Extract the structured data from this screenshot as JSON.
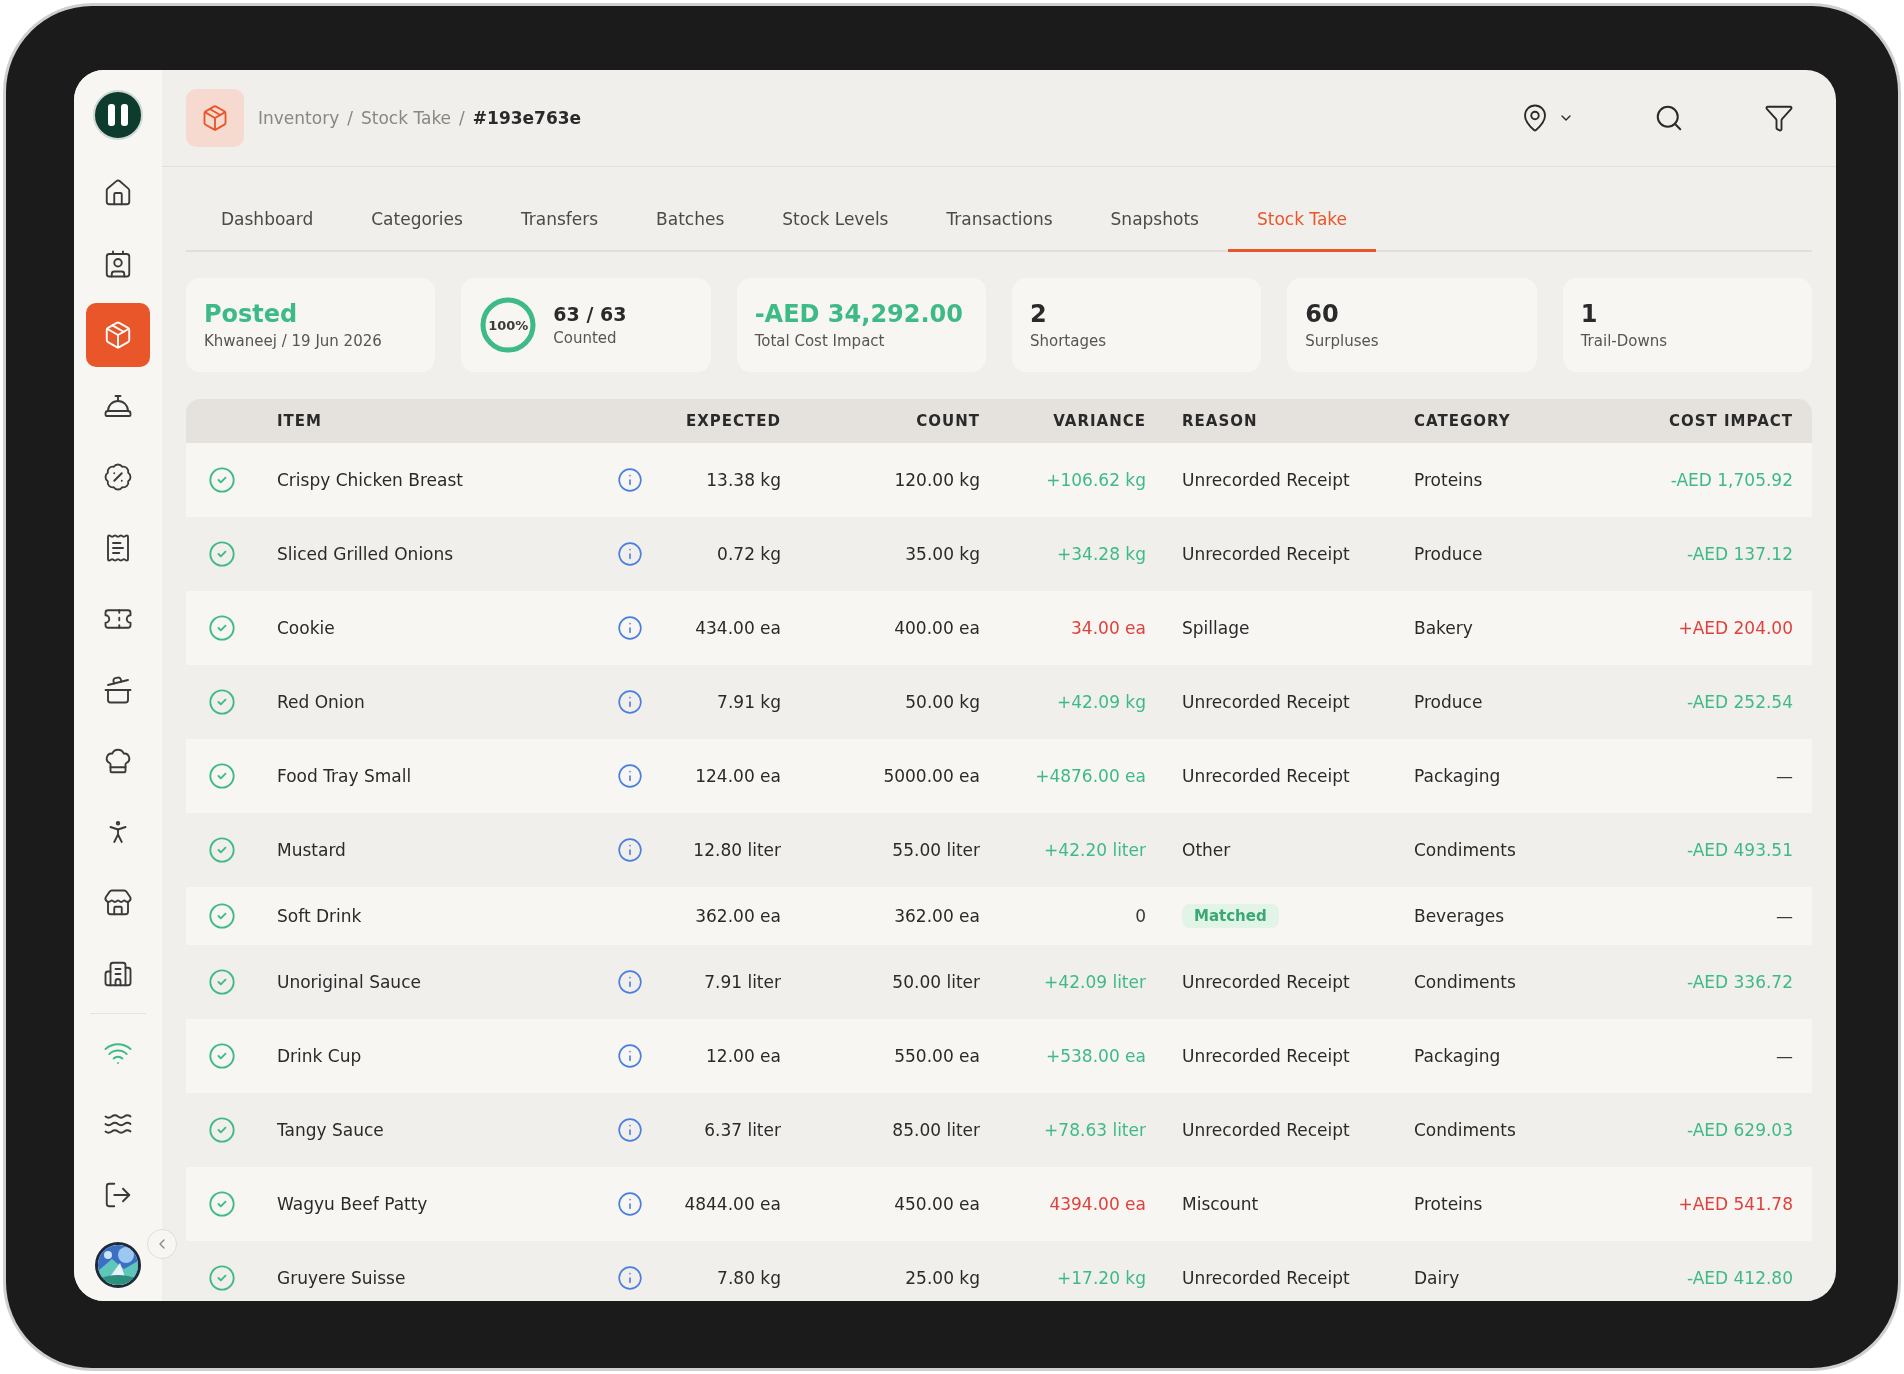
{
  "sidebar": {
    "nav": [
      {
        "selected": false
      },
      {
        "selected": false
      },
      {
        "selected": true
      },
      {
        "selected": false
      },
      {
        "selected": false
      },
      {
        "selected": false
      },
      {
        "selected": false
      },
      {
        "selected": false
      },
      {
        "selected": false
      },
      {
        "selected": false
      },
      {
        "selected": false
      },
      {
        "selected": false
      }
    ],
    "tools": [
      {
        "kind": "status",
        "on": true
      },
      {
        "kind": "link"
      },
      {
        "kind": "link"
      }
    ]
  },
  "header": {
    "separator": "/",
    "breadcrumb": [
      {
        "label": "Inventory",
        "current": false
      },
      {
        "label": "Stock Take",
        "current": false
      },
      {
        "label": "#193e763e",
        "current": true
      }
    ]
  },
  "tabs": [
    {
      "label": "Dashboard",
      "selected": false
    },
    {
      "label": "Categories",
      "selected": false
    },
    {
      "label": "Transfers",
      "selected": false
    },
    {
      "label": "Batches",
      "selected": false
    },
    {
      "label": "Stock Levels",
      "selected": false
    },
    {
      "label": "Transactions",
      "selected": false
    },
    {
      "label": "Snapshots",
      "selected": false
    },
    {
      "label": "Stock Take",
      "selected": true
    }
  ],
  "stats": [
    {
      "kind": "status",
      "value": "Posted",
      "label": "Khwaneej / 19 Jun 2026",
      "color": "#3dba86"
    },
    {
      "kind": "progress",
      "level": 1,
      "percent": "100%",
      "value": "63 / 63",
      "label": "Counted",
      "color": "#2a2a2a"
    },
    {
      "kind": "metric",
      "value": "-AED 34,292.00",
      "label": "Total Cost Impact",
      "color": "#3dba86"
    },
    {
      "kind": "metric",
      "value": "2",
      "label": "Shortages",
      "color": "#2a2a2a"
    },
    {
      "kind": "metric",
      "value": "60",
      "label": "Surpluses",
      "color": "#2a2a2a"
    },
    {
      "kind": "metric",
      "value": "1",
      "label": "Trail-Downs",
      "color": "#2a2a2a"
    }
  ],
  "table": {
    "columns": [
      "ITEM",
      "EXPECTED",
      "COUNT",
      "VARIANCE",
      "REASON",
      "CATEGORY",
      "COST IMPACT"
    ],
    "rows": [
      {
        "checked": true,
        "item": "Crispy Chicken Breast",
        "info": true,
        "expected": "13.38 kg",
        "count": "120.00 kg",
        "variance": {
          "text": "+106.62 kg",
          "color": "#3dba86"
        },
        "reason": {
          "text": "Unrecorded Receipt",
          "kind": "text"
        },
        "category": "Proteins",
        "cost": {
          "text": "-AED 1,705.92",
          "color": "#3dba86"
        }
      },
      {
        "checked": true,
        "item": "Sliced Grilled Onions",
        "info": true,
        "expected": "0.72 kg",
        "count": "35.00 kg",
        "variance": {
          "text": "+34.28 kg",
          "color": "#3dba86"
        },
        "reason": {
          "text": "Unrecorded Receipt",
          "kind": "text"
        },
        "category": "Produce",
        "cost": {
          "text": "-AED 137.12",
          "color": "#3dba86"
        }
      },
      {
        "checked": true,
        "item": "Cookie",
        "info": true,
        "expected": "434.00 ea",
        "count": "400.00 ea",
        "variance": {
          "text": "34.00 ea",
          "color": "#e0413c"
        },
        "reason": {
          "text": "Spillage",
          "kind": "text"
        },
        "category": "Bakery",
        "cost": {
          "text": "+AED 204.00",
          "color": "#e0413c"
        }
      },
      {
        "checked": true,
        "item": "Red Onion",
        "info": true,
        "expected": "7.91 kg",
        "count": "50.00 kg",
        "variance": {
          "text": "+42.09 kg",
          "color": "#3dba86"
        },
        "reason": {
          "text": "Unrecorded Receipt",
          "kind": "text"
        },
        "category": "Produce",
        "cost": {
          "text": "-AED 252.54",
          "color": "#3dba86"
        }
      },
      {
        "checked": true,
        "item": "Food Tray Small",
        "info": true,
        "expected": "124.00 ea",
        "count": "5000.00 ea",
        "variance": {
          "text": "+4876.00 ea",
          "color": "#3dba86"
        },
        "reason": {
          "text": "Unrecorded Receipt",
          "kind": "text"
        },
        "category": "Packaging",
        "cost": {
          "text": "—",
          "color": "#3a3a3a"
        }
      },
      {
        "checked": true,
        "item": "Mustard",
        "info": true,
        "expected": "12.80 liter",
        "count": "55.00 liter",
        "variance": {
          "text": "+42.20 liter",
          "color": "#3dba86"
        },
        "reason": {
          "text": "Other",
          "kind": "text"
        },
        "category": "Condiments",
        "cost": {
          "text": "-AED 493.51",
          "color": "#3dba86"
        }
      },
      {
        "checked": true,
        "item": "Soft Drink",
        "info": false,
        "expected": "362.00 ea",
        "count": "362.00 ea",
        "variance": {
          "text": "0",
          "color": "#3a3a3a"
        },
        "reason": {
          "text": "Matched",
          "kind": "badge"
        },
        "category": "Beverages",
        "cost": {
          "text": "—",
          "color": "#3a3a3a"
        }
      },
      {
        "checked": true,
        "item": "Unoriginal Sauce",
        "info": true,
        "expected": "7.91 liter",
        "count": "50.00 liter",
        "variance": {
          "text": "+42.09 liter",
          "color": "#3dba86"
        },
        "reason": {
          "text": "Unrecorded Receipt",
          "kind": "text"
        },
        "category": "Condiments",
        "cost": {
          "text": "-AED 336.72",
          "color": "#3dba86"
        }
      },
      {
        "checked": true,
        "item": "Drink Cup",
        "info": true,
        "expected": "12.00 ea",
        "count": "550.00 ea",
        "variance": {
          "text": "+538.00 ea",
          "color": "#3dba86"
        },
        "reason": {
          "text": "Unrecorded Receipt",
          "kind": "text"
        },
        "category": "Packaging",
        "cost": {
          "text": "—",
          "color": "#3a3a3a"
        }
      },
      {
        "checked": true,
        "item": "Tangy Sauce",
        "info": true,
        "expected": "6.37 liter",
        "count": "85.00 liter",
        "variance": {
          "text": "+78.63 liter",
          "color": "#3dba86"
        },
        "reason": {
          "text": "Unrecorded Receipt",
          "kind": "text"
        },
        "category": "Condiments",
        "cost": {
          "text": "-AED 629.03",
          "color": "#3dba86"
        }
      },
      {
        "checked": true,
        "item": "Wagyu Beef Patty",
        "info": true,
        "expected": "4844.00 ea",
        "count": "450.00 ea",
        "variance": {
          "text": "4394.00 ea",
          "color": "#e0413c"
        },
        "reason": {
          "text": "Miscount",
          "kind": "text"
        },
        "category": "Proteins",
        "cost": {
          "text": "+AED 541.78",
          "color": "#e0413c"
        }
      },
      {
        "checked": true,
        "item": "Gruyere Suisse",
        "info": true,
        "expected": "7.80 kg",
        "count": "25.00 kg",
        "variance": {
          "text": "+17.20 kg",
          "color": "#3dba86"
        },
        "reason": {
          "text": "Unrecorded Receipt",
          "kind": "text"
        },
        "category": "Dairy",
        "cost": {
          "text": "-AED 412.80",
          "color": "#3dba86"
        }
      }
    ]
  }
}
